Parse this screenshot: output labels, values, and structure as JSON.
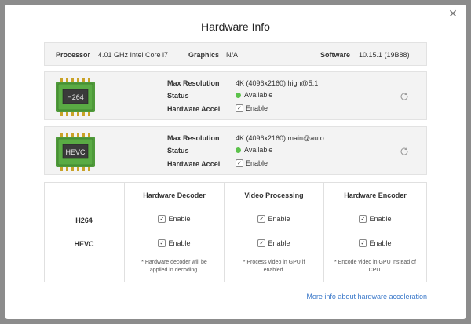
{
  "dialog": {
    "title": "Hardware Info"
  },
  "system": {
    "processor_label": "Processor",
    "processor_value": "4.01 GHz Intel Core i7",
    "graphics_label": "Graphics",
    "graphics_value": "N/A",
    "software_label": "Software",
    "software_value": "10.15.1 (19B88)"
  },
  "codecs": [
    {
      "chip": "H264",
      "max_res_label": "Max Resolution",
      "max_res_value": "4K (4096x2160) high@5.1",
      "status_label": "Status",
      "status_value": "Available",
      "accel_label": "Hardware Accel",
      "accel_value": "Enable",
      "accel_checked": true
    },
    {
      "chip": "HEVC",
      "max_res_label": "Max Resolution",
      "max_res_value": "4K (4096x2160) main@auto",
      "status_label": "Status",
      "status_value": "Available",
      "accel_label": "Hardware Accel",
      "accel_value": "Enable",
      "accel_checked": true
    }
  ],
  "matrix": {
    "columns": [
      "Hardware Decoder",
      "Video Processing",
      "Hardware Encoder"
    ],
    "rows": [
      "H264",
      "HEVC"
    ],
    "cell_label": "Enable",
    "notes": [
      "* Hardware decoder will be applied in decoding.",
      "* Process video in GPU if enabled.",
      "* Encode video in GPU instead of CPU."
    ]
  },
  "footer": {
    "link": "More info about hardware acceleration"
  },
  "colors": {
    "status_dot": "#5cc24b",
    "link": "#3a78c9",
    "chip_green": "#4f9a3a"
  }
}
